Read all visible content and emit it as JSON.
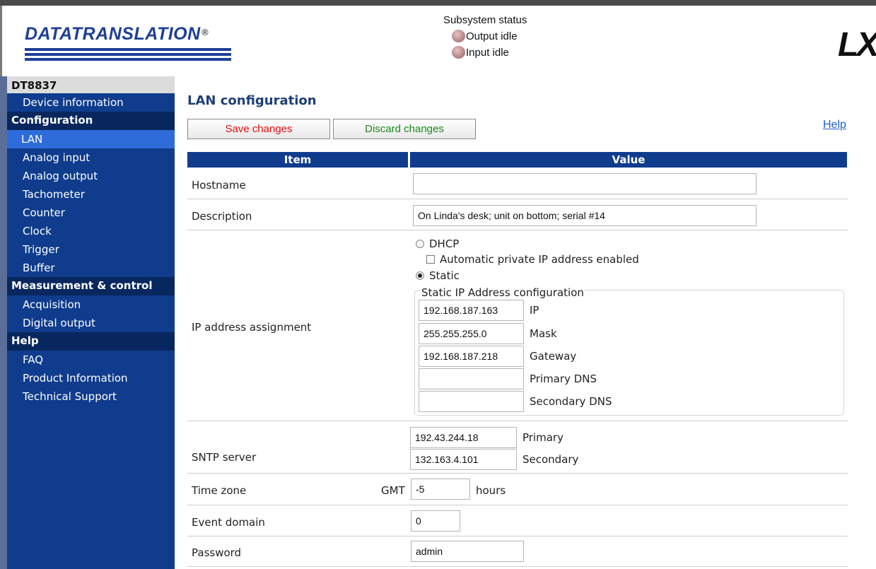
{
  "header": {
    "logo_text": "DATATRANSLATION",
    "logo_mark": "®",
    "status_title": "Subsystem status",
    "output_status": "Output idle",
    "input_status": "Input idle",
    "lxi_logo": "LXI"
  },
  "sidebar": {
    "device": "DT8837",
    "device_info": "Device information",
    "sections": [
      {
        "heading": "Configuration",
        "items": [
          "LAN",
          "Analog input",
          "Analog output",
          "Tachometer",
          "Counter",
          "Clock",
          "Trigger",
          "Buffer"
        ]
      },
      {
        "heading": "Measurement & control",
        "items": [
          "Acquisition",
          "Digital output"
        ]
      },
      {
        "heading": "Help",
        "items": [
          "FAQ",
          "Product Information",
          "Technical Support"
        ]
      }
    ],
    "active_item": "LAN"
  },
  "main": {
    "title": "LAN configuration",
    "save_label": "Save changes",
    "discard_label": "Discard changes",
    "help_label": "Help",
    "col_item": "Item",
    "col_value": "Value",
    "hostname_label": "Hostname",
    "hostname_value": "",
    "description_label": "Description",
    "description_value": "On Linda's desk; unit on bottom; serial #14",
    "ip_label": "IP address assignment",
    "dhcp_label": "DHCP",
    "auto_private_label": "Automatic private IP address enabled",
    "static_label": "Static",
    "static_legend": "Static IP Address configuration",
    "ip_value": "192.168.187.163",
    "ip_field_label": "IP",
    "mask_value": "255.255.255.0",
    "mask_field_label": "Mask",
    "gateway_value": "192.168.187.218",
    "gateway_field_label": "Gateway",
    "primary_dns_value": "",
    "primary_dns_label": "Primary DNS",
    "secondary_dns_value": "",
    "secondary_dns_label": "Secondary DNS",
    "sntp_label": "SNTP server",
    "sntp_primary_value": "192.43.244.18",
    "sntp_primary_label": "Primary",
    "sntp_secondary_value": "132.163.4.101",
    "sntp_secondary_label": "Secondary",
    "timezone_label": "Time zone",
    "gmt_label": "GMT",
    "timezone_value": "-5",
    "hours_label": "hours",
    "event_domain_label": "Event domain",
    "event_domain_value": "0",
    "password_label": "Password",
    "password_value": "admin"
  }
}
